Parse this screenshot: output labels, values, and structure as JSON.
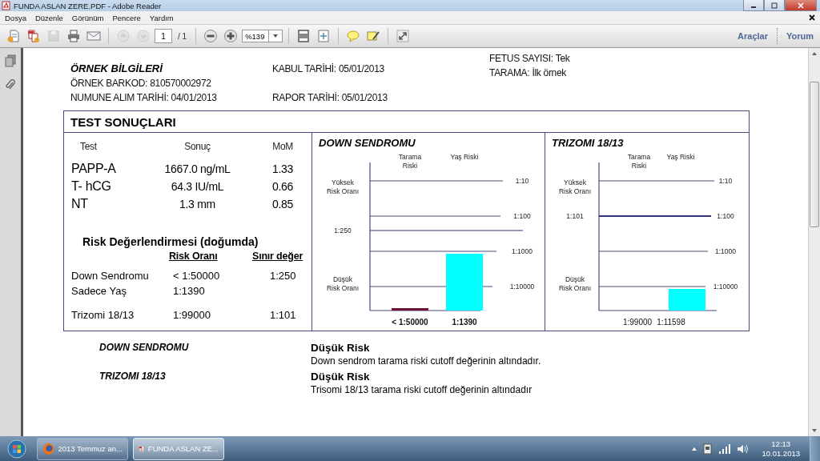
{
  "window": {
    "title": "FUNDA ASLAN ZERE.PDF - Adobe Reader"
  },
  "menu": [
    "Dosya",
    "Düzenle",
    "Görünüm",
    "Pencere",
    "Yardım"
  ],
  "toolbar": {
    "page": "1",
    "page_total": "/ 1",
    "zoom": "%139",
    "links": [
      "Araçlar",
      "Yorum"
    ]
  },
  "sample_info": {
    "heading": "ÖRNEK BİLGİLERİ",
    "lines": [
      "ÖRNEK BARKOD: 810570002972",
      "NUMUNE ALIM TARİHİ: 04/01/2013"
    ],
    "dates": [
      "KABUL TARİHİ: 05/01/2013",
      "RAPOR TARİHİ: 05/01/2013"
    ],
    "screening": [
      "FETUS SAYISI: Tek",
      "TARAMA: İlk örnek"
    ]
  },
  "results": {
    "title": "TEST SONUÇLARI",
    "columns": [
      "Test",
      "Sonuç",
      "MoM"
    ],
    "rows": [
      [
        "PAPP-A",
        "1667.0 ng/mL",
        "1.33"
      ],
      [
        "T- hCG",
        "64.3  IU/mL",
        "0.66"
      ],
      [
        "NT",
        "1.3 mm",
        "0.85"
      ]
    ],
    "risk": {
      "title": "Risk Değerlendirmesi  (doğumda)",
      "columns": [
        "Risk Oranı",
        "Sınır değer"
      ],
      "rows": [
        {
          "name": "Down Sendromu",
          "ratio": "< 1:50000",
          "cutoff": "1:250"
        },
        {
          "name": "Sadece Yaş",
          "ratio": "1:1390"
        },
        {
          "name": "Trizomi 18/13",
          "ratio": "1:99000",
          "cutoff": "1:101"
        }
      ]
    }
  },
  "charts": [
    {
      "title": "DOWN SENDROMU",
      "side_labels": [
        "Yüksek\nRisk Oranı",
        "Düşük\nRisk Oranı"
      ],
      "cutoff_label": "1:250",
      "tick_labels": [
        "1:10",
        "1:100",
        "1:1000",
        "1:10000"
      ],
      "bars": [
        {
          "category": "Tarama\nRiski",
          "value_label": "< 1:50000",
          "color": "#6b1530"
        },
        {
          "category": "Yaş Riski",
          "value_label": "1:1390",
          "color": "#00ffff"
        }
      ]
    },
    {
      "title": "TRIZOMI 18/13",
      "side_labels": [
        "Yüksek\nRisk Oranı",
        "Düşük\nRisk Oranı"
      ],
      "cutoff_label": "1:101",
      "tick_labels": [
        "1:10",
        "1:100",
        "1:1000",
        "1:10000"
      ],
      "bars": [
        {
          "category": "Tarama\nRiski",
          "value_label": "1:99000"
        },
        {
          "category": "Yaş Riski",
          "value_label": "1:11598",
          "color": "#00ffff"
        }
      ]
    }
  ],
  "interpretation": [
    {
      "condition": "DOWN SENDROMU",
      "result": "Düşük Risk",
      "note": "Down sendrom tarama riski cutoff değerinin altındadır."
    },
    {
      "condition": "TRIZOMI 18/13",
      "result": "Düşük Risk",
      "note": "Trisomi 18/13 tarama riski cutoff değerinin altındadır"
    }
  ],
  "taskbar": {
    "items": [
      {
        "label": "2013 Temmuz an...",
        "kind": "browser",
        "selected": false
      },
      {
        "label": "FUNDA ASLAN ZE...",
        "kind": "pdf",
        "selected": true
      }
    ],
    "time": "12:13",
    "date": "10.01.2013"
  }
}
